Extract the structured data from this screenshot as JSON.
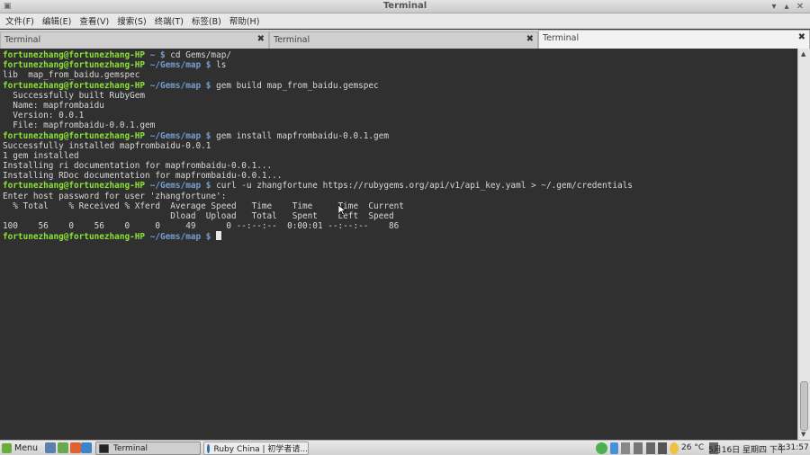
{
  "window": {
    "title": "Terminal"
  },
  "menu": [
    "文件(F)",
    "编辑(E)",
    "查看(V)",
    "搜索(S)",
    "终端(T)",
    "标签(B)",
    "帮助(H)"
  ],
  "tabs": [
    {
      "label": "Terminal",
      "close": "✖"
    },
    {
      "label": "Terminal",
      "close": "✖"
    },
    {
      "label": "Terminal",
      "close": "✖"
    }
  ],
  "terminal": {
    "lines": [
      {
        "user": "fortunezhang@fortunezhang-HP",
        "path": " ~ $",
        "text": " cd Gems/map/"
      },
      {
        "user": "fortunezhang@fortunezhang-HP",
        "path": " ~/Gems/map $",
        "text": " ls"
      },
      {
        "text": "lib  map_from_baidu.gemspec"
      },
      {
        "user": "fortunezhang@fortunezhang-HP",
        "path": " ~/Gems/map $",
        "text": " gem build map_from_baidu.gemspec"
      },
      {
        "text": "  Successfully built RubyGem"
      },
      {
        "text": "  Name: mapfrombaidu"
      },
      {
        "text": "  Version: 0.0.1"
      },
      {
        "text": "  File: mapfrombaidu-0.0.1.gem"
      },
      {
        "user": "fortunezhang@fortunezhang-HP",
        "path": " ~/Gems/map $",
        "text": " gem install mapfrombaidu-0.0.1.gem"
      },
      {
        "text": "Successfully installed mapfrombaidu-0.0.1"
      },
      {
        "text": "1 gem installed"
      },
      {
        "text": "Installing ri documentation for mapfrombaidu-0.0.1..."
      },
      {
        "text": "Installing RDoc documentation for mapfrombaidu-0.0.1..."
      },
      {
        "user": "fortunezhang@fortunezhang-HP",
        "path": " ~/Gems/map $",
        "text": " curl -u zhangfortune https://rubygems.org/api/v1/api_key.yaml > ~/.gem/credentials"
      },
      {
        "text": "Enter host password for user 'zhangfortune':"
      },
      {
        "text": "  % Total    % Received % Xferd  Average Speed   Time    Time     Time  Current"
      },
      {
        "text": "                                 Dload  Upload   Total   Spent    Left  Speed"
      },
      {
        "text": "100    56    0    56    0     0     49      0 --:--:--  0:00:01 --:--:--    86"
      },
      {
        "user": "fortunezhang@fortunezhang-HP",
        "path": " ~/Gems/map $",
        "text": " ",
        "cursor": true
      }
    ]
  },
  "taskbar": {
    "menu_label": "Menu",
    "windows": [
      {
        "label": "Terminal",
        "icon": "terminal-icon"
      },
      {
        "label": "Ruby China | 初学者请...",
        "icon": "browser-icon"
      }
    ],
    "temperature": "26 °C",
    "date": "5月16日 星期四 下午",
    "time": "3:31:57"
  },
  "colors": {
    "terminal_bg": "#303030",
    "prompt_user": "#8ae234",
    "prompt_path": "#729fcf",
    "terminal_text": "#d8d8d8"
  }
}
